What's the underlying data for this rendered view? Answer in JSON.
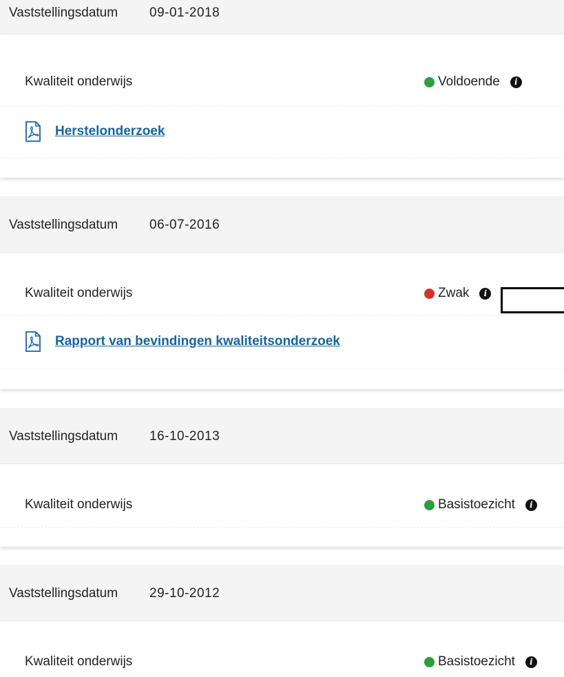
{
  "colors": {
    "good": "#2e9e3a",
    "weak": "#d8322c",
    "link": "#1565a0",
    "header_rule": "#1f3f76"
  },
  "icons": {
    "info": "info-icon",
    "document": "pdf-document-icon"
  },
  "entries": [
    {
      "date_label": "Vaststellingsdatum",
      "date": "09-01-2018",
      "quality_label": "Kwaliteit onderwijs",
      "status": "Voldoende",
      "status_color": "good",
      "document": "Herstelonderzoek"
    },
    {
      "date_label": "Vaststellingsdatum",
      "date": "06-07-2016",
      "quality_label": "Kwaliteit onderwijs",
      "status": "Zwak",
      "status_color": "weak",
      "document": "Rapport van bevindingen kwaliteitsonderzoek"
    },
    {
      "date_label": "Vaststellingsdatum",
      "date": "16-10-2013",
      "quality_label": "Kwaliteit onderwijs",
      "status": "Basistoezicht",
      "status_color": "good"
    },
    {
      "date_label": "Vaststellingsdatum",
      "date": "29-10-2012",
      "quality_label": "Kwaliteit onderwijs",
      "status": "Basistoezicht",
      "status_color": "good"
    }
  ]
}
